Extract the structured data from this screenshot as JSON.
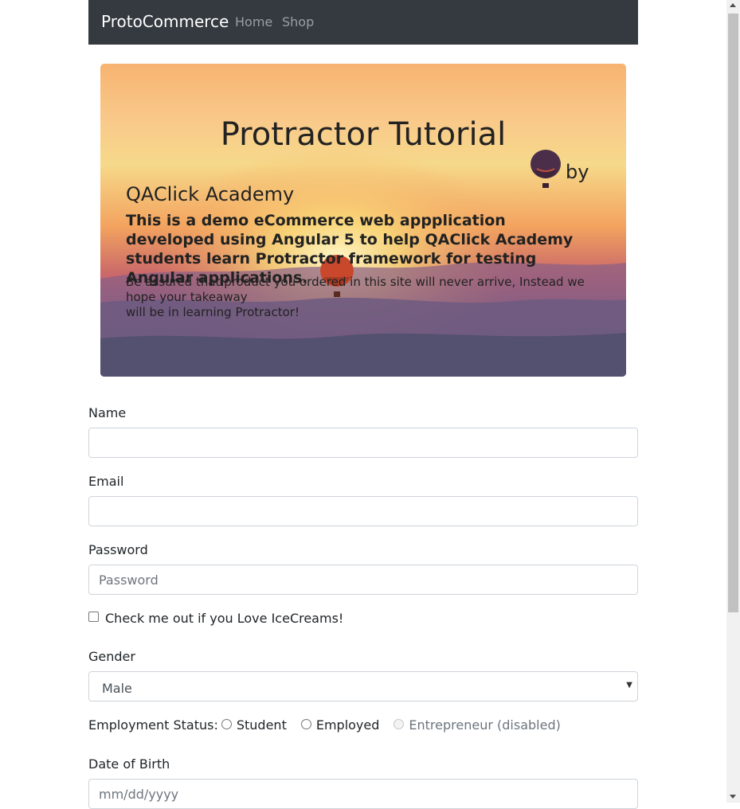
{
  "navbar": {
    "brand": "ProtoCommerce",
    "links": [
      "Home",
      "Shop"
    ]
  },
  "hero": {
    "title": "Protractor Tutorial",
    "by": "by",
    "academy": "QAClick Academy",
    "lead": "This is a demo eCommerce web appplication developed using Angular 5 to help QAClick Academy students learn Protractor framework for testing Angular applications.",
    "small_line1": "Be assured that product you ordered in this site will never arrive, Instead we hope your takeaway",
    "small_line2": "will be in learning Protractor!"
  },
  "form": {
    "name_label": "Name",
    "name_value": "",
    "email_label": "Email",
    "email_value": "",
    "password_label": "Password",
    "password_placeholder": "Password",
    "checkbox_label": "Check me out if you Love IceCreams!",
    "gender_label": "Gender",
    "gender_value": "Male",
    "employment_label": "Employment Status:",
    "employment_options": [
      "Student",
      "Employed",
      "Entrepreneur (disabled)"
    ],
    "dob_label": "Date of Birth",
    "dob_placeholder": "mm/dd/yyyy"
  }
}
